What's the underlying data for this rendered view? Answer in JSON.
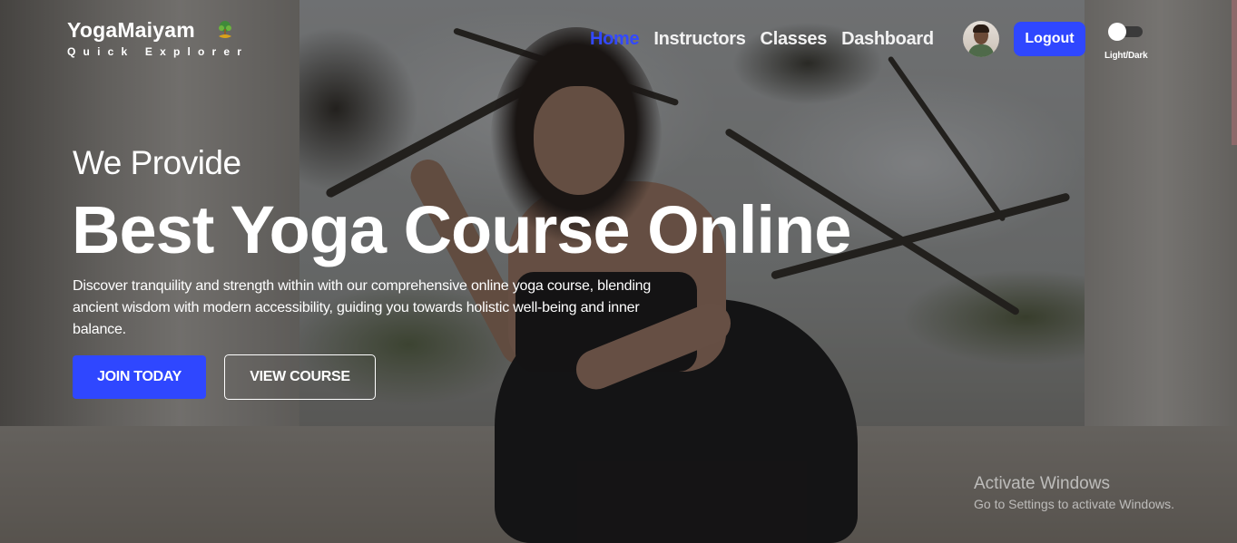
{
  "brand": {
    "title": "YogaMaiyam",
    "tagline": "Quick Explorer",
    "logo_icon": "lotus-tree-logo-icon"
  },
  "nav": {
    "links": [
      {
        "label": "Home",
        "active": true
      },
      {
        "label": "Instructors",
        "active": false
      },
      {
        "label": "Classes",
        "active": false
      },
      {
        "label": "Dashboard",
        "active": false
      }
    ],
    "avatar_icon": "user-avatar-icon",
    "logout_label": "Logout",
    "theme_toggle_label": "Light/Dark"
  },
  "hero": {
    "kicker": "We Provide",
    "title": "Best Yoga Course Online",
    "description": "Discover tranquility and strength within with our comprehensive online yoga course, blending ancient wisdom with modern accessibility, guiding you towards holistic well-being and inner balance.",
    "primary_button": "JOIN TODAY",
    "secondary_button": "VIEW COURSE"
  },
  "watermark": {
    "title": "Activate Windows",
    "subtitle": "Go to Settings to activate Windows."
  },
  "colors": {
    "accent": "#2f47ff",
    "active_nav": "#3349ff",
    "text": "#ffffff"
  }
}
